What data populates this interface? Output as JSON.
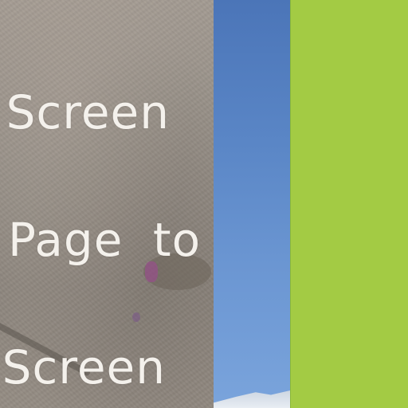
{
  "menu": {
    "items": [
      {
        "label": "n Screen"
      },
      {
        "label": "Page to"
      },
      {
        "label": "s Screen"
      }
    ]
  },
  "panels": {
    "green": {
      "color": "#a3cb44"
    },
    "sky": {
      "color": "#5a86c6"
    }
  }
}
